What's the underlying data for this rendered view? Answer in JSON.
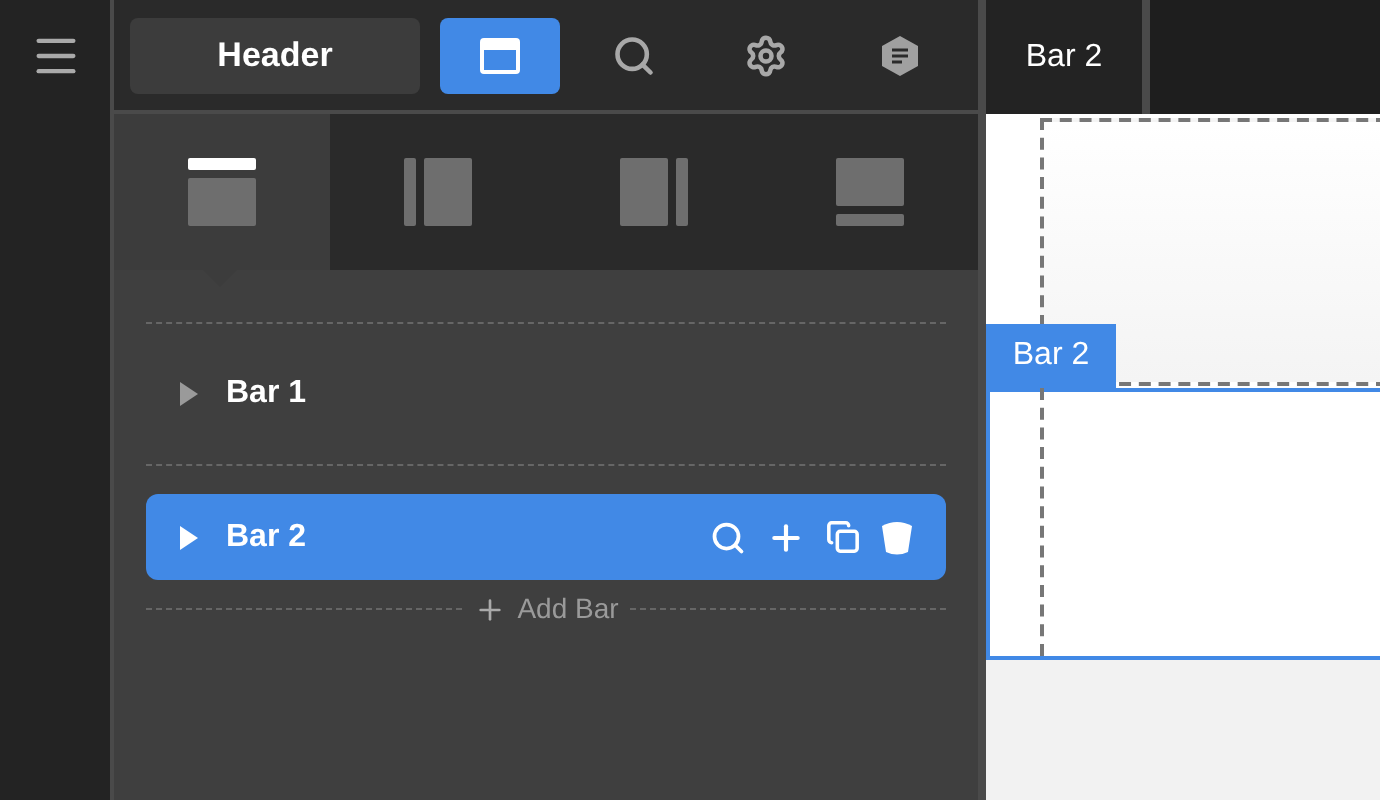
{
  "header_button": {
    "label": "Header"
  },
  "toolbar": [
    {
      "kind": "layout",
      "selected": true
    },
    {
      "kind": "search",
      "selected": false
    },
    {
      "kind": "settings",
      "selected": false
    },
    {
      "kind": "note",
      "selected": false
    }
  ],
  "preview_tab": {
    "label": "Bar 2"
  },
  "layout_tabs": [
    {
      "kind": "top",
      "selected": true
    },
    {
      "kind": "left",
      "selected": false
    },
    {
      "kind": "right",
      "selected": false
    },
    {
      "kind": "bottom",
      "selected": false
    }
  ],
  "bars": [
    {
      "label": "Bar 1",
      "selected": false
    },
    {
      "label": "Bar 2",
      "selected": true
    }
  ],
  "add_bar": {
    "label": "Add Bar"
  },
  "canvas": {
    "bar_label": "Bar 2"
  }
}
